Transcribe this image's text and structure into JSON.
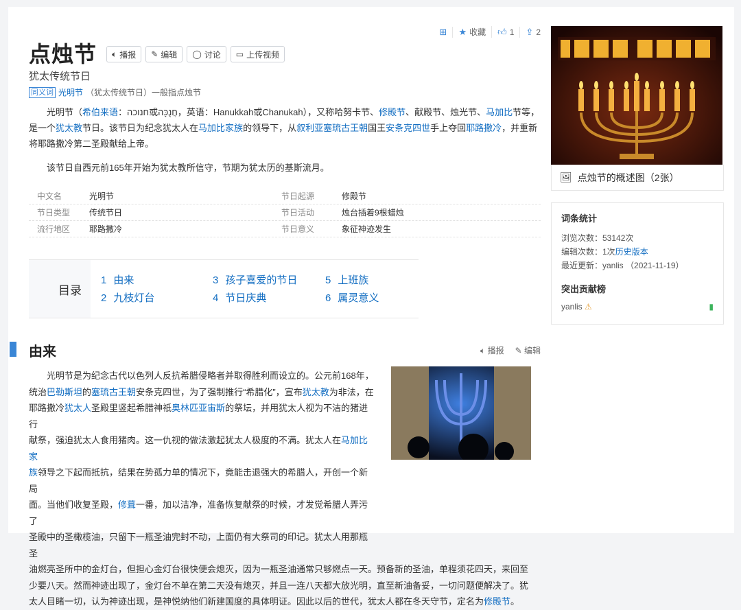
{
  "top_actions": {
    "favorite_label": "收藏",
    "like_count": "1",
    "share_count": "2"
  },
  "title": "点烛节",
  "tools": {
    "broadcast": "播报",
    "edit": "编辑",
    "discuss": "讨论",
    "upload_video": "上传视频"
  },
  "subtitle": "犹太传统节日",
  "synonym": {
    "tag": "同义词",
    "link": "光明节",
    "rest": "（犹太传统节日）一般指点烛节"
  },
  "intro": {
    "p1_parts": [
      "光明节（",
      "希伯来语",
      "：חנוכה或חֲנֻכָּה，英语：Hanukkah或Chanukah），又称哈努卡节、",
      "修殿节",
      "、献殿节、烛光节、",
      "马加比",
      "节等，是一个",
      "犹太教",
      "节日。该节日为纪念犹太人在",
      "马加比家族",
      "的领导下，从",
      "叙利亚塞琉古王朝",
      "国王",
      "安条克四世",
      "手上夺回",
      "耶路撒冷",
      "，并重新将耶路撒冷第二圣殿献给上帝。"
    ],
    "p2": "该节日自西元前165年开始为犹太教所信守，节期为犹太历的基斯流月。"
  },
  "basic_info": [
    {
      "k1": "中文名",
      "v1": "光明节",
      "k2": "节日起源",
      "v2": "修殿节"
    },
    {
      "k1": "节日类型",
      "v1": "传统节日",
      "k2": "节日活动",
      "v2": "烛台插着9根蜡烛"
    },
    {
      "k1": "流行地区",
      "v1": "耶路撒冷",
      "k2": "节日意义",
      "v2": "象征神迹发生"
    }
  ],
  "catalog": {
    "label": "目录",
    "items": [
      {
        "num": "1",
        "text": "由来"
      },
      {
        "num": "2",
        "text": "九枝灯台"
      },
      {
        "num": "3",
        "text": "孩子喜爱的节日"
      },
      {
        "num": "4",
        "text": "节日庆典"
      },
      {
        "num": "5",
        "text": "上班族"
      },
      {
        "num": "6",
        "text": "属灵意义"
      }
    ]
  },
  "section1": {
    "title": "由来",
    "broadcast": "播报",
    "edit": "编辑",
    "lines": [
      [
        "光明节是为纪念古代以色列人反抗希腊侵略者并取得胜利而设立的。公元前168年，"
      ],
      [
        "统治",
        "巴勒斯坦",
        "的",
        "塞琉古王朝",
        "安条克四世，为了强制推行“希腊化”，宣布",
        "犹太教",
        "为非法，在"
      ],
      [
        "耶路撒冷",
        "犹太人",
        "圣殿里竖起希腊神祇",
        "奥林匹亚宙斯",
        "的祭坛，并用犹太人视为不洁的猪进行"
      ],
      [
        "献祭，强迫犹太人食用猪肉。这一仇视的做法激起犹太人极度的不满。犹太人在",
        "马加比家"
      ],
      [
        "族",
        "领导之下起而抵抗，结果在势孤力单的情况下，竟能击退强大的希腊人，开创一个新局"
      ],
      [
        "面。当他们收复圣殿，",
        "修葺",
        "一番，加以洁净，准备恢复献祭的时候，才发觉希腊人弄污了"
      ],
      [
        "圣殿中的圣橄榄油，只留下一瓶圣油完封不动，上面仍有大祭司的印记。犹太人用那瓶圣"
      ],
      [
        "油燃亮圣所中的金灯台，但担心金灯台很快便会熄灭，因为一瓶圣油通常只够燃点一天。预备新的圣油，单程须花四天，来回至"
      ],
      [
        "少要八天。然而神迹出现了，金灯台不单在第二天没有熄灭，并且一连八天都大放光明，直至新油备妥，一切问题便解决了。犹"
      ],
      [
        "太人目睹一切，认为神迹出现，是神悦纳他们新建国度的具体明证。因此以后的世代，犹太人都在冬天守节，定名为",
        "修殿节",
        "。"
      ]
    ]
  },
  "side": {
    "caption": "点烛节的概述图（2张）",
    "stats_title": "词条统计",
    "views": "浏览次数：53142次",
    "edits_prefix": "编辑次数：1次",
    "edits_link": "历史版本",
    "last_update": "最近更新：yanlis （2021-11-19）",
    "contrib_title": "突出贡献榜",
    "contributor": "yanlis"
  },
  "colors": {
    "accent": "#3a86d6",
    "link": "#136ec2"
  }
}
